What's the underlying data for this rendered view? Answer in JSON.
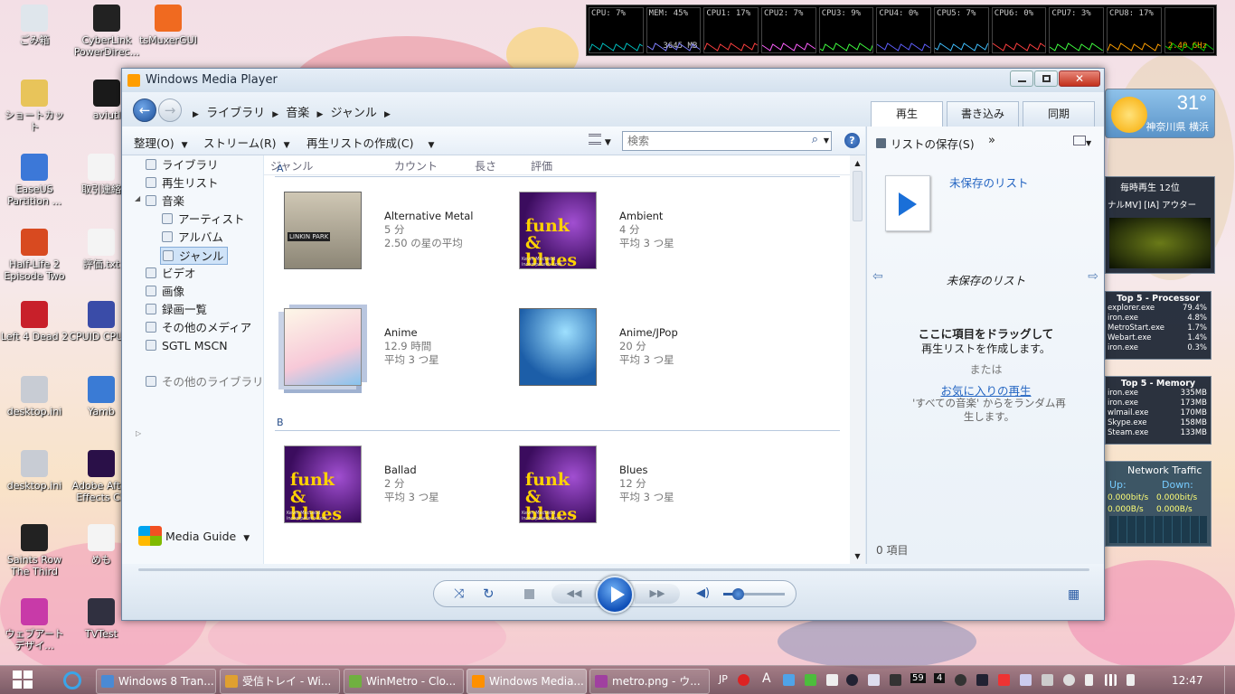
{
  "desktop_icons": [
    {
      "label": "ごみ箱",
      "icon": "recycle-bin-icon"
    },
    {
      "label": "CyberLink PowerDirec...",
      "icon": "cyberlink-icon"
    },
    {
      "label": "tsMuxerGUI",
      "icon": "tsmuxer-icon"
    },
    {
      "label": "ショートカット",
      "icon": "folder-icon"
    },
    {
      "label": "aviutl",
      "icon": "aviutl-icon"
    },
    {
      "label": "EaseUS Partition ...",
      "icon": "easeus-icon"
    },
    {
      "label": "取引連絡",
      "icon": "text-file-icon"
    },
    {
      "label": "Half-Life 2 Episode Two",
      "icon": "halflife-icon"
    },
    {
      "label": "評価.txt",
      "icon": "text-file-icon"
    },
    {
      "label": "Left 4 Dead 2",
      "icon": "l4d2-icon"
    },
    {
      "label": "CPUID CPU-Z",
      "icon": "cpuz-icon"
    },
    {
      "label": "desktop.ini",
      "icon": "settings-file-icon"
    },
    {
      "label": "Yamb",
      "icon": "yamb-icon"
    },
    {
      "label": "desktop.ini",
      "icon": "settings-file-icon"
    },
    {
      "label": "Adobe After Effects CS",
      "icon": "after-effects-icon"
    },
    {
      "label": "Saints Row The Third",
      "icon": "saints-row-icon"
    },
    {
      "label": "めも",
      "icon": "text-file-icon"
    },
    {
      "label": "ウェブアート デザイ...",
      "icon": "web-art-icon"
    },
    {
      "label": "TVTest",
      "icon": "tvtest-icon"
    }
  ],
  "perf": {
    "cpu": "CPU: 7%",
    "mem": "MEM: 45%",
    "mem_mb": "3645 MB",
    "cores": [
      "CPU1: 17%",
      "CPU2: 7%",
      "CPU3: 9%",
      "CPU4: 0%",
      "CPU5: 7%",
      "CPU6: 0%",
      "CPU7: 3%",
      "CPU8: 17%"
    ],
    "freq": "2.40 GHz",
    "colors": [
      "#00c0c0",
      "#8080ff",
      "#ff4040",
      "#ff60ff",
      "#40ff40",
      "#6060ff",
      "#40c0ff",
      "#ff4040",
      "#40ff40",
      "#ffa000"
    ]
  },
  "window": {
    "title": "Windows Media Player",
    "breadcrumb": [
      "ライブラリ",
      "音楽",
      "ジャンル"
    ],
    "tabs": [
      "再生",
      "書き込み",
      "同期"
    ],
    "toolbar": {
      "organize": "整理(O)",
      "stream": "ストリーム(R)",
      "create_playlist": "再生リストの作成(C)",
      "search_placeholder": "検索"
    },
    "columns": [
      "ジャンル",
      "カウント",
      "長さ",
      "評価"
    ],
    "nav": [
      {
        "label": "ライブラリ",
        "level": 0
      },
      {
        "label": "再生リスト",
        "level": 0
      },
      {
        "label": "音楽",
        "level": 0
      },
      {
        "label": "アーティスト",
        "level": 1
      },
      {
        "label": "アルバム",
        "level": 1
      },
      {
        "label": "ジャンル",
        "level": 1
      },
      {
        "label": "ビデオ",
        "level": 0
      },
      {
        "label": "画像",
        "level": 0
      },
      {
        "label": "録画一覧",
        "level": 0
      },
      {
        "label": "その他のメディア",
        "level": 0
      },
      {
        "label": "SGTL MSCN",
        "level": 0
      },
      {
        "label": "その他のライブラリ",
        "level": 0
      }
    ],
    "media_guide": "Media Guide",
    "groups": [
      {
        "letter": "A",
        "items": [
          {
            "name": "Alternative Metal",
            "count": "5 分",
            "rating": "2.50 の星の平均",
            "art": "linkin"
          },
          {
            "name": "Ambient",
            "count": "4 分",
            "rating": "平均 3 つ星",
            "art": "funk"
          },
          {
            "name": "Anime",
            "count": "12.9 時間",
            "rating": "平均 3 つ星",
            "art": "anime-stack"
          },
          {
            "name": "Anime/JPop",
            "count": "20 分",
            "rating": "平均 3 つ星",
            "art": "anime"
          }
        ]
      },
      {
        "letter": "B",
        "items": [
          {
            "name": "Ballad",
            "count": "2 分",
            "rating": "平均 3 つ星",
            "art": "funk"
          },
          {
            "name": "Blues",
            "count": "12 分",
            "rating": "平均 3 つ星",
            "art": "funk"
          }
        ]
      }
    ],
    "art_text": {
      "funk": "funk & blues",
      "funk_credit": "Kevin MacLeod    incompetech.com",
      "linkin": "LINKIN PARK"
    },
    "right": {
      "save_list": "リストの保存(S)",
      "more": "»",
      "unsaved_link": "未保存のリスト",
      "unsaved_title": "未保存のリスト",
      "drag_here": "ここに項目をドラッグして",
      "create_playlist": "再生リストを作成します。",
      "or": "または",
      "favorites_link": "お気に入りの再生",
      "random": "'すべての音楽' からをランダム再生します。",
      "item_count": "0 項目"
    }
  },
  "gadgets": {
    "weather": {
      "temp": "31°",
      "location": "神奈川県 横浜"
    },
    "music": {
      "title": "毎時再生 12位",
      "line": "ナルMV]   [IA] アウター"
    },
    "processor": {
      "title": "Top 5 - Processor",
      "rows": [
        [
          "explorer.exe",
          "79.4%"
        ],
        [
          "iron.exe",
          "4.8%"
        ],
        [
          "MetroStart.exe",
          "1.7%"
        ],
        [
          "Webart.exe",
          "1.4%"
        ],
        [
          "iron.exe",
          "0.3%"
        ]
      ]
    },
    "memory": {
      "title": "Top 5 - Memory",
      "rows": [
        [
          "iron.exe",
          "335MB"
        ],
        [
          "iron.exe",
          "173MB"
        ],
        [
          "wlmail.exe",
          "170MB"
        ],
        [
          "Skype.exe",
          "158MB"
        ],
        [
          "Steam.exe",
          "133MB"
        ]
      ]
    },
    "network": {
      "title": "Network Traffic",
      "up": "Up:",
      "down": "Down:",
      "up_bit": "0.000bit/s",
      "down_bit": "0.000bit/s",
      "up_b": "0.000B/s",
      "down_b": "0.000B/s"
    }
  },
  "taskbar": {
    "items": [
      {
        "label": "Windows 8 Tran...",
        "color": "#4a8ad4"
      },
      {
        "label": "受信トレイ - Wi...",
        "color": "#e0a030"
      },
      {
        "label": "WinMetro - Clo...",
        "color": "#70b040"
      },
      {
        "label": "Windows Media...",
        "color": "#ff9000"
      },
      {
        "label": "metro.png - ウ...",
        "color": "#a040a0"
      }
    ],
    "lang": "JP",
    "ime": "A",
    "tray_num1": "59",
    "tray_num2": "4",
    "time": "12:47"
  }
}
